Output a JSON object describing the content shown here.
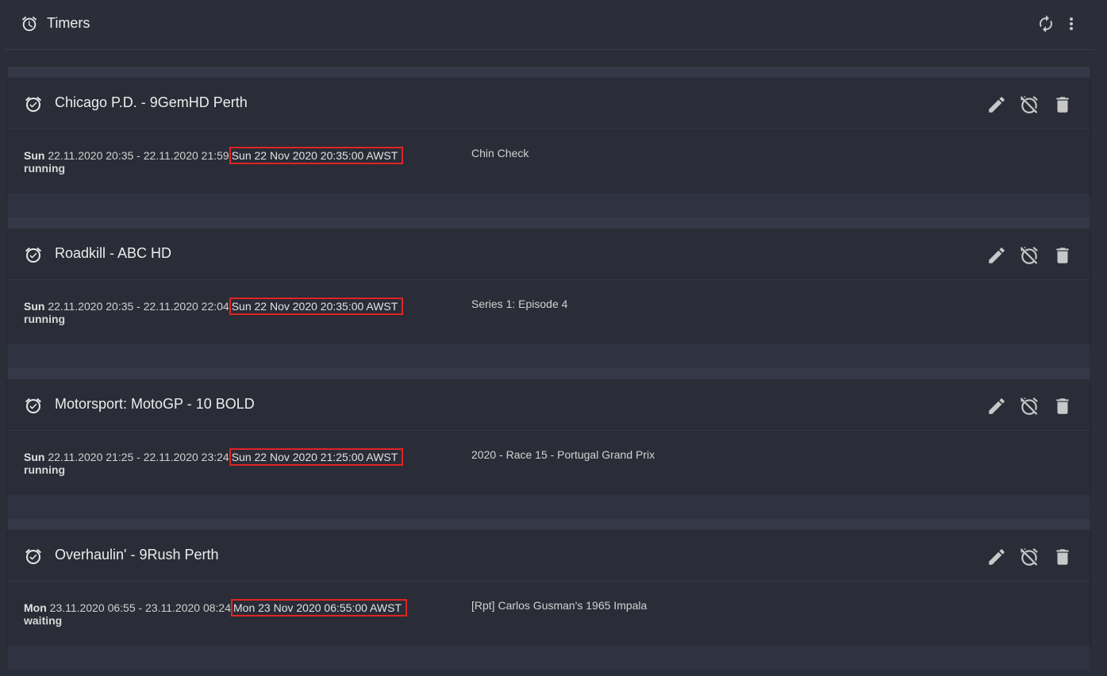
{
  "header": {
    "title": "Timers",
    "title_icon": "alarm-clock-icon",
    "refresh_icon": "refresh-icon",
    "more_icon": "more-vertical-icon"
  },
  "timers": [
    {
      "name": "Chicago P.D. - 9GemHD Perth",
      "day": "Sun",
      "range": "22.11.2020 20:35 - 22.11.2020 21:59",
      "start_time": "Sun 22 Nov 2020 20:35:00 AWST",
      "status": "running",
      "description": "Chin Check"
    },
    {
      "name": "Roadkill - ABC HD",
      "day": "Sun",
      "range": "22.11.2020 20:35 - 22.11.2020 22:04",
      "start_time": "Sun 22 Nov 2020 20:35:00 AWST",
      "status": "running",
      "description": "Series 1: Episode 4"
    },
    {
      "name": "Motorsport: MotoGP - 10 BOLD",
      "day": "Sun",
      "range": "22.11.2020 21:25 - 22.11.2020 23:24",
      "start_time": "Sun 22 Nov 2020 21:25:00 AWST",
      "status": "running",
      "description": "2020 - Race 15 - Portugal Grand Prix"
    },
    {
      "name": "Overhaulin' - 9Rush Perth",
      "day": "Mon",
      "range": "23.11.2020 06:55 - 23.11.2020 08:24",
      "start_time": "Mon 23 Nov 2020 06:55:00 AWST",
      "status": "waiting",
      "description": "[Rpt] Carlos Gusman's 1965 Impala"
    }
  ],
  "icons": {
    "item": "alarm-check-icon",
    "edit": "pencil-icon",
    "cancel": "alarm-off-icon",
    "delete": "trash-icon"
  },
  "colors": {
    "background": "#2b2d38",
    "card": "#2a2c37",
    "highlight_border": "#e02424",
    "icon": "#c8c8c8"
  }
}
